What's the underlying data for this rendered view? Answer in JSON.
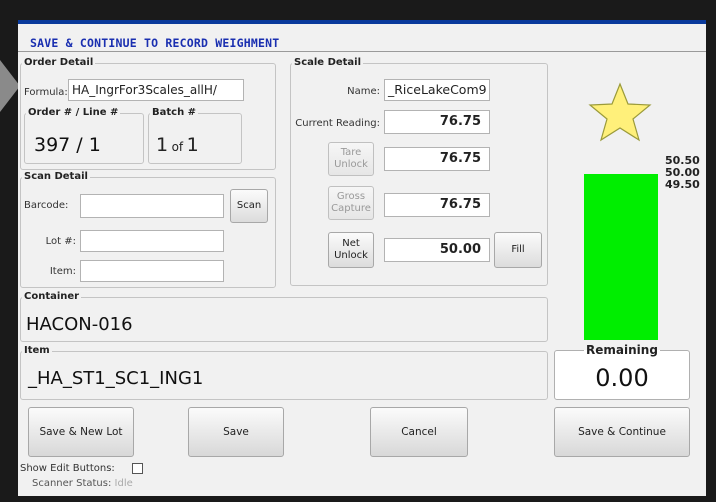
{
  "title": "SAVE & CONTINUE TO RECORD WEIGHMENT",
  "order_detail": {
    "legend": "Order Detail",
    "formula_label": "Formula:",
    "formula_value": "HA_IngrFor3Scales_allH/",
    "order_line_legend": "Order # / Line #",
    "order_line_value": "397 / 1",
    "batch_legend": "Batch #",
    "batch_number": "1",
    "batch_of": "of",
    "batch_total": "1"
  },
  "scan_detail": {
    "legend": "Scan Detail",
    "barcode_label": "Barcode:",
    "barcode_value": "",
    "scan_button": "Scan",
    "lot_label": "Lot #:",
    "lot_value": "",
    "item_label": "Item:",
    "item_value": ""
  },
  "scale_detail": {
    "legend": "Scale Detail",
    "name_label": "Name:",
    "name_value": "_RiceLakeCom9",
    "current_reading_label": "Current Reading:",
    "current_reading": "76.75",
    "tare_button": [
      "Tare",
      "Unlock"
    ],
    "tare_value": "76.75",
    "gross_button": [
      "Gross",
      "Capture"
    ],
    "gross_value": "76.75",
    "net_button": [
      "Net",
      "Unlock"
    ],
    "net_value": "50.00",
    "fill_button": "Fill"
  },
  "container": {
    "legend": "Container",
    "value": "HACON-016"
  },
  "item": {
    "legend": "Item",
    "value": "_HA_ST1_SC1_ING1"
  },
  "gauge": {
    "labels": [
      "50.50",
      "50.00",
      "49.50"
    ],
    "fill_color": "#00ee00",
    "star_color": "#fff07a",
    "fill_fraction": 1.0
  },
  "remaining": {
    "legend": "Remaining",
    "value": "0.00"
  },
  "buttons": {
    "save_new_lot": "Save & New Lot",
    "save": "Save",
    "cancel": "Cancel",
    "save_continue": "Save & Continue"
  },
  "show_edit_label": "Show Edit Buttons:",
  "scanner_status_label": "Scanner Status:",
  "scanner_status_value": "Idle"
}
